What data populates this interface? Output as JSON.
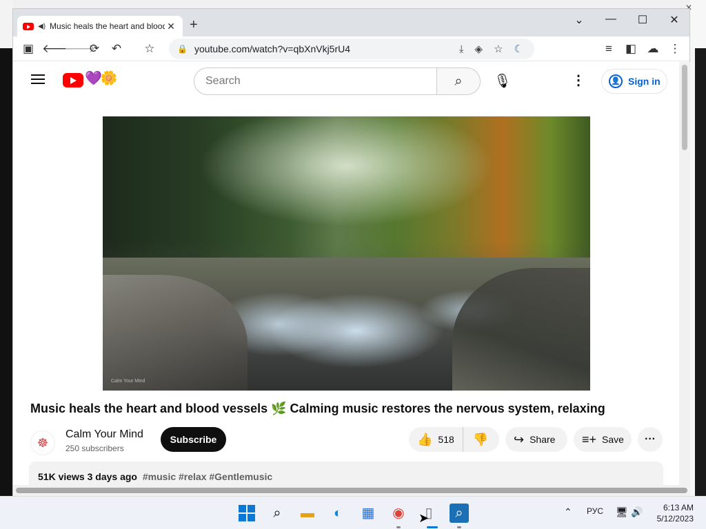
{
  "browser": {
    "tab_title": "Music heals the heart and blood",
    "new_tab_label": "+",
    "url": "youtube.com/watch?v=qbXnVkj5rU4",
    "window_controls": {
      "list": "⌄",
      "minimize": "—",
      "maximize": "☐",
      "close": "✕"
    }
  },
  "youtube": {
    "search_placeholder": "Search",
    "sign_in_label": "Sign in",
    "video": {
      "title": "Music heals the heart and blood vessels 🌿 Calming music restores the nervous system, relaxing",
      "watermark": "Calm Your Mind"
    },
    "channel": {
      "name": "Calm Your Mind",
      "subscribers": "250 subscribers",
      "subscribe_label": "Subscribe"
    },
    "actions": {
      "likes": "518",
      "share_label": "Share",
      "save_label": "Save"
    },
    "description": {
      "views": "51K views",
      "age": "3 days ago",
      "tags": "#music #relax #Gentlemusic"
    }
  },
  "taskbar": {
    "language": "РУС",
    "time": "6:13 AM",
    "date": "5/12/2023"
  },
  "colors": {
    "youtube_red": "#ff0000",
    "link_blue": "#065fd4",
    "subscribe_bg": "#0f0f0f"
  },
  "icons": [
    "search-icon",
    "mic-icon",
    "like-icon",
    "dislike-icon",
    "share-icon",
    "save-icon",
    "back-icon",
    "forward-icon",
    "reload-icon",
    "star-icon",
    "moon-icon"
  ]
}
